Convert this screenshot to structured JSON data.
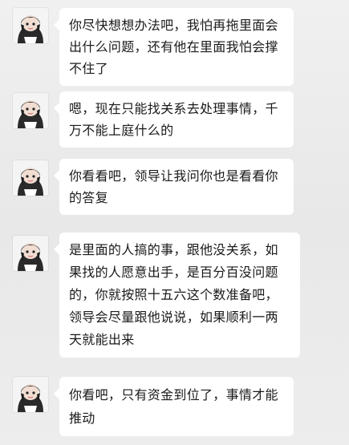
{
  "messages": [
    {
      "text": "你尽快想想办法吧，我怕再拖里面会出什么问题，还有他在里面我怕会撑不住了",
      "avatar": "user-avatar"
    },
    {
      "text": "嗯，现在只能找关系去处理事情，千万不能上庭什么的",
      "avatar": "user-avatar"
    },
    {
      "text": "你看看吧，领导让我问你也是看看你的答复",
      "avatar": "user-avatar"
    },
    {
      "text": "是里面的人搞的事，跟他没关系，如果找的人愿意出手，是百分百没问题的，你就按照十五六这个数准备吧，领导会尽量跟他说说，如果顺利一两天就能出来",
      "avatar": "user-avatar"
    },
    {
      "text": "你看吧，只有资金到位了，事情才能推动",
      "avatar": "user-avatar"
    }
  ],
  "colors": {
    "bubble": "#ffffff",
    "background": "#ececec",
    "text": "#1a1a1a"
  }
}
